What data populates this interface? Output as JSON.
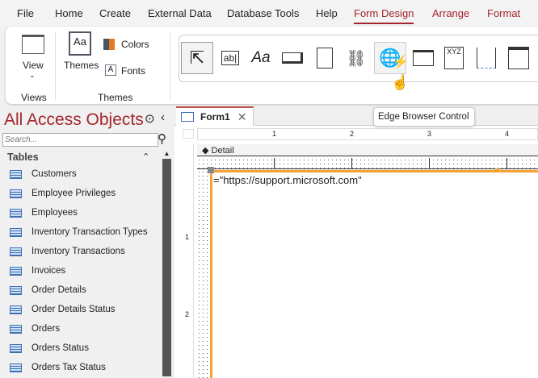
{
  "menu": {
    "items": [
      "File",
      "Home",
      "Create",
      "External Data",
      "Database Tools",
      "Help",
      "Form Design",
      "Arrange",
      "Format"
    ],
    "active": "Form Design"
  },
  "ribbon": {
    "view_label": "View",
    "views_group": "Views",
    "themes_label": "Themes",
    "colors_label": "Colors",
    "fonts_label": "Fonts",
    "themes_group": "Themes",
    "tooltip": "Edge Browser Control",
    "tool_icons": [
      "select-icon",
      "textbox-icon",
      "label-icon",
      "button-icon",
      "tab-control-icon",
      "hyperlink-icon",
      "edge-browser-icon",
      "navigation-control-icon",
      "option-group-icon",
      "page-break-icon",
      "combo-box-icon"
    ],
    "label_sample": "Aa",
    "option_group_sample": "XYZ",
    "textbox_sample": "ab|"
  },
  "nav": {
    "title": "All Access Objects",
    "search_placeholder": "Search...",
    "section": "Tables",
    "items": [
      "Customers",
      "Employee Privileges",
      "Employees",
      "Inventory Transaction Types",
      "Inventory Transactions",
      "Invoices",
      "Order Details",
      "Order Details Status",
      "Orders",
      "Orders Status",
      "Orders Tax Status"
    ]
  },
  "doc": {
    "tab": "Form1",
    "section": "Detail",
    "control_source": "=\"https://support.microsoft.com\"",
    "ruler": [
      "1",
      "2",
      "3",
      "4"
    ],
    "vruler": [
      "1",
      "2"
    ]
  },
  "colors": {
    "accent": "#a4262c",
    "selection": "#f7a130"
  }
}
